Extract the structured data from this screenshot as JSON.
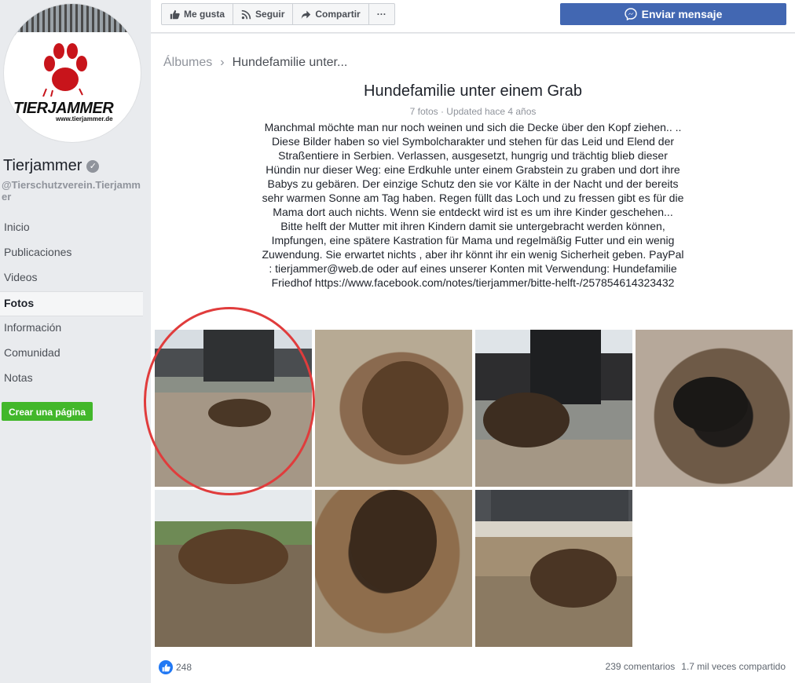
{
  "page": {
    "logo_text": "TIERJAMMER",
    "logo_url": "www.tierjammer.de",
    "name": "Tierjammer",
    "handle": "@Tierschutzverein.Tierjammer",
    "verified_glyph": "✓"
  },
  "nav": {
    "items": [
      {
        "label": "Inicio"
      },
      {
        "label": "Publicaciones"
      },
      {
        "label": "Videos"
      },
      {
        "label": "Fotos",
        "active": true
      },
      {
        "label": "Información"
      },
      {
        "label": "Comunidad"
      },
      {
        "label": "Notas"
      }
    ],
    "create_page": "Crear una página"
  },
  "topbar": {
    "like": "Me gusta",
    "follow": "Seguir",
    "share": "Compartir",
    "more": "···",
    "send_message": "Enviar mensaje"
  },
  "breadcrumb": {
    "albums": "Álbumes",
    "separator": "›",
    "current": "Hundefamilie unter..."
  },
  "album": {
    "title": "Hundefamilie unter einem Grab",
    "meta": "7 fotos · Updated hace 4 años",
    "description": "Manchmal möchte man nur noch weinen und sich die Decke über den Kopf ziehen.. .. Diese Bilder haben so viel Symbolcharakter und stehen für das Leid und Elend der Straßentiere in Serbien. Verlassen, ausgesetzt, hungrig und trächtig blieb dieser Hündin nur dieser Weg: eine Erdkuhle unter einem Grabstein zu graben und dort ihre Babys zu gebären. Der einzige Schutz den sie vor Kälte in der Nacht und der bereits sehr warmen Sonne am Tag haben. Regen füllt das Loch und zu fressen gibt es für die Mama dort auch nichts. Wenn sie entdeckt wird ist es um ihre Kinder geschehen... Bitte helft der Mutter mit ihren Kindern damit sie untergebracht werden können, Impfungen, eine spätere Kastration für Mama und regelmäßig Futter und ein wenig Zuwendung. Sie erwartet nichts , aber ihr könnt ihr ein wenig Sicherheit geben. PayPal : tierjammer@web.de oder auf eines unserer Konten mit Verwendung: Hundefamilie Friedhof https://www.facebook.com/notes/tierjammer/bitte-helft-/257854614323432"
  },
  "footer": {
    "like_count": "248",
    "comments": "239 comentarios",
    "shares": "1.7 mil veces compartido"
  }
}
